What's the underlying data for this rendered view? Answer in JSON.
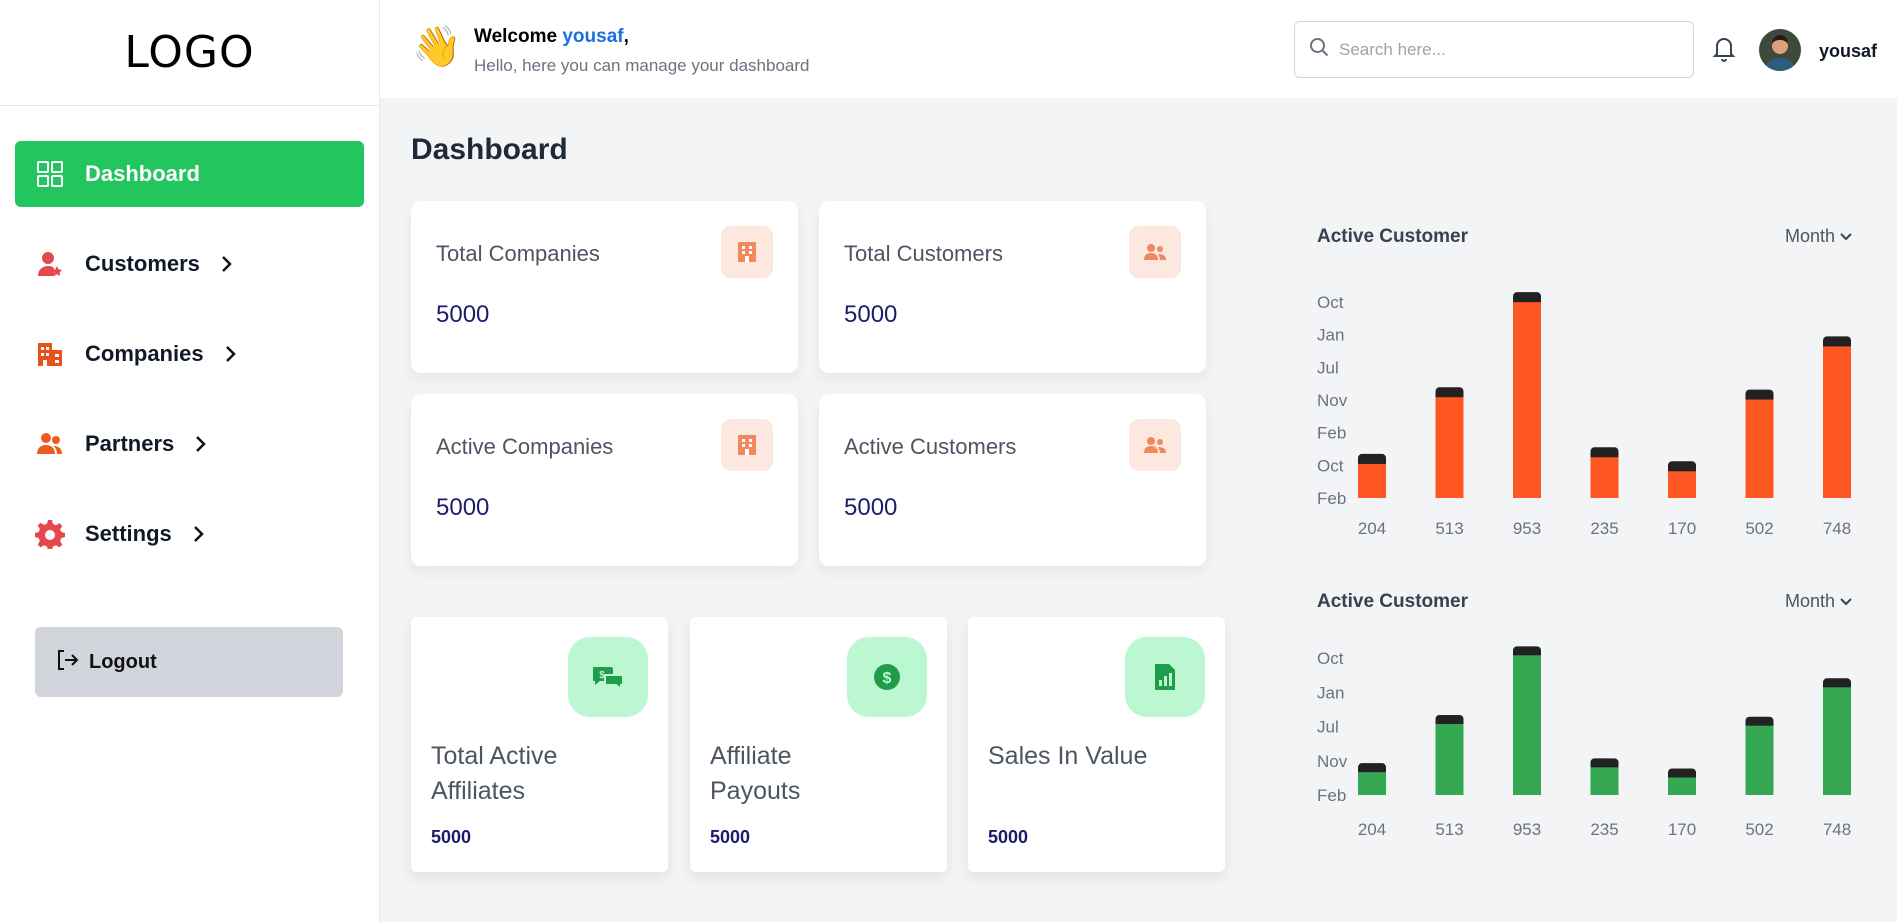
{
  "sidebar": {
    "logo": "LOGO",
    "items": [
      {
        "label": "Dashboard",
        "icon": "grid-icon"
      },
      {
        "label": "Customers",
        "icon": "user-star-icon"
      },
      {
        "label": "Companies",
        "icon": "building-icon"
      },
      {
        "label": "Partners",
        "icon": "users-icon"
      },
      {
        "label": "Settings",
        "icon": "gear-icon"
      }
    ],
    "logout": "Logout"
  },
  "header": {
    "welcome": "Welcome",
    "username": "yousaf",
    "subtitle": "Hello, here you can manage your dashboard",
    "search_placeholder": "Search here...",
    "user": "yousaf"
  },
  "main": {
    "title": "Dashboard",
    "stats": [
      {
        "label": "Total Companies",
        "value": "5000",
        "icon": "building-icon"
      },
      {
        "label": "Total Customers",
        "value": "5000",
        "icon": "users-icon"
      },
      {
        "label": "Active Companies",
        "value": "5000",
        "icon": "building-icon"
      },
      {
        "label": "Active Customers",
        "value": "5000",
        "icon": "users-icon"
      }
    ],
    "affiliates": [
      {
        "label": "Total Active Affiliates",
        "value": "5000",
        "icon": "chat-money-icon"
      },
      {
        "label": "Affiliate Payouts",
        "value": "5000",
        "icon": "dollar-icon"
      },
      {
        "label": "Sales In Value",
        "value": "5000",
        "icon": "report-icon"
      }
    ]
  },
  "colors": {
    "accent": "#22c55e",
    "bar_orange": "#ff5722",
    "bar_green": "#34a853",
    "bar_cap": "#222222"
  },
  "chart_data": [
    {
      "type": "bar",
      "title": "Active Customer",
      "period": "Month",
      "categories": [
        "204",
        "513",
        "953",
        "235",
        "170",
        "502",
        "748"
      ],
      "y_tick_labels": [
        "Oct",
        "Jan",
        "Jul",
        "Nov",
        "Feb",
        "Oct",
        "Feb"
      ],
      "values": [
        204,
        513,
        953,
        235,
        170,
        502,
        748
      ],
      "ylim": [
        0,
        1000
      ]
    },
    {
      "type": "bar",
      "title": "Active Customer",
      "period": "Month",
      "categories": [
        "204",
        "513",
        "953",
        "235",
        "170",
        "502",
        "748"
      ],
      "y_tick_labels": [
        "Oct",
        "Jan",
        "Jul",
        "Nov",
        "Feb"
      ],
      "values": [
        204,
        513,
        953,
        235,
        170,
        502,
        748
      ],
      "ylim": [
        0,
        1000
      ]
    }
  ]
}
